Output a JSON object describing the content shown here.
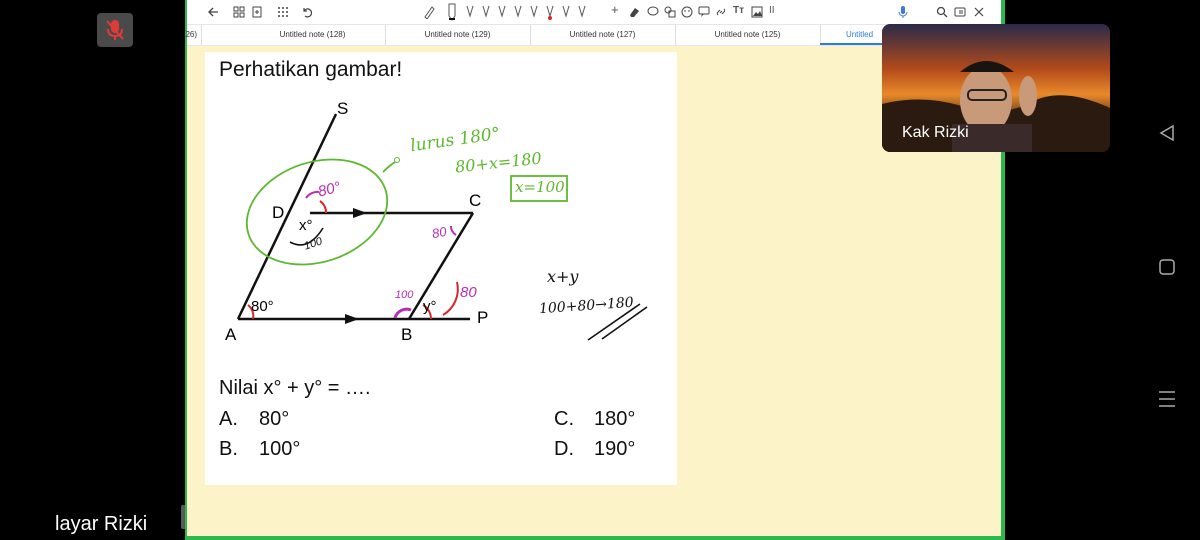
{
  "meeting": {
    "share_label": "layar Rizki",
    "mic_state": "muted",
    "collapse_glyph": "›"
  },
  "webcam": {
    "participant_name": "Kak Rizki"
  },
  "toolbar": {
    "icons": [
      "back-arrow-icon",
      "grid-icon",
      "add-page-icon",
      "apps-icon",
      "undo-icon",
      "pen-icon",
      "eraser-icon",
      "lasso-icon",
      "shapes-icon",
      "sticker-icon",
      "text-icon",
      "image-icon",
      "mic-icon",
      "search-icon",
      "share-icon",
      "more-icon"
    ],
    "text_tool_label": "Tт",
    "pause_label": "II",
    "plus_label": "+"
  },
  "tabs": [
    {
      "label": "26)",
      "active": false
    },
    {
      "label": "Untitled note (128)",
      "active": false
    },
    {
      "label": "Untitled note (129)",
      "active": false
    },
    {
      "label": "Untitled note (127)",
      "active": false
    },
    {
      "label": "Untitled note (125)",
      "active": false
    },
    {
      "label": "Untitled",
      "active": true
    }
  ],
  "worksheet": {
    "heading": "Perhatikan gambar!",
    "question": "Nilai x° + y° = ….",
    "options": [
      {
        "letter": "A.",
        "value": "80°"
      },
      {
        "letter": "B.",
        "value": "100°"
      },
      {
        "letter": "C.",
        "value": "180°"
      },
      {
        "letter": "D.",
        "value": "190°"
      }
    ],
    "figure": {
      "points": {
        "S": "S",
        "D": "D",
        "C": "C",
        "A": "A",
        "B": "B",
        "P": "P"
      },
      "angle_labels": {
        "A": "80°",
        "D": "x°",
        "B": "y°"
      }
    },
    "annotations": {
      "green_note_1": "lurus 180°",
      "green_note_2": "80+x=180",
      "green_answer": "x=100",
      "pink_80_top": "80°",
      "pink_80_c": "80",
      "pink_80_b": "80",
      "pink_100_b": "100",
      "black_100_d": "100",
      "sum_label": "x+y",
      "sum_expr": "100+80→180"
    }
  },
  "colors": {
    "accent_green": "#2db84d",
    "ink_green": "#5cb82e",
    "ink_pink": "#b52fb5",
    "ink_red": "#d9262c",
    "page_bg": "#fdf3c8"
  }
}
